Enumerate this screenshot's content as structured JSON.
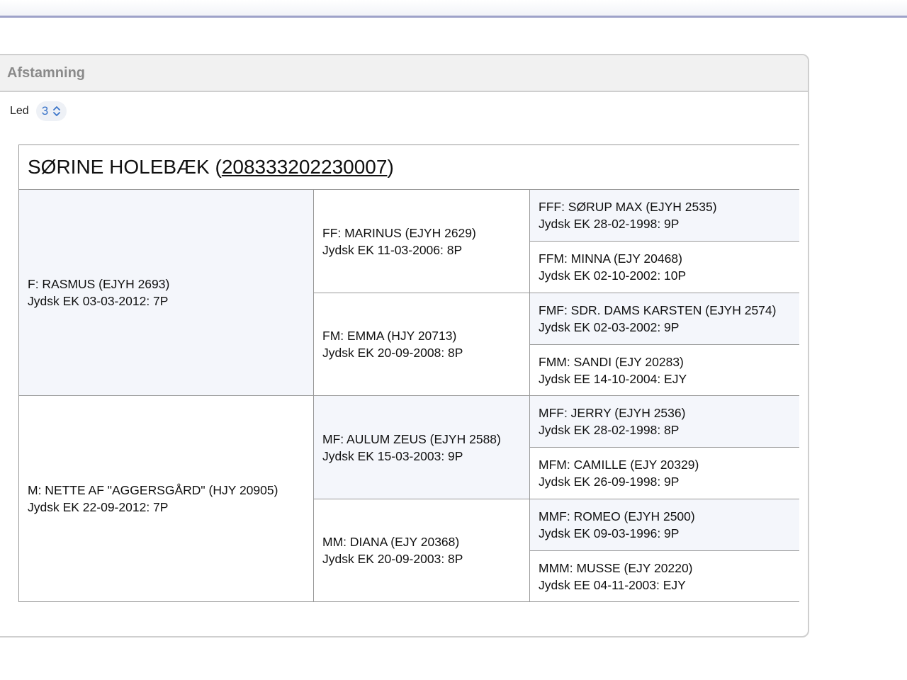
{
  "panel": {
    "title": "Afstamning",
    "led_label": "Led",
    "led_value": "3"
  },
  "pedigree": {
    "animal_name": "SØRINE HOLEBÆK",
    "animal_regno": "208333202230007",
    "F": {
      "name": "F: RASMUS (EJYH 2693)",
      "rating": "Jydsk EK 03-03-2012: 7P"
    },
    "M": {
      "name": "M: NETTE AF \"AGGERSGÅRD\" (HJY 20905)",
      "rating": "Jydsk EK 22-09-2012: 7P"
    },
    "FF": {
      "name": "FF: MARINUS (EJYH 2629)",
      "rating": "Jydsk EK 11-03-2006: 8P"
    },
    "FM": {
      "name": "FM: EMMA (HJY 20713)",
      "rating": "Jydsk EK 20-09-2008: 8P"
    },
    "MF": {
      "name": "MF: AULUM ZEUS (EJYH 2588)",
      "rating": "Jydsk EK 15-03-2003: 9P"
    },
    "MM": {
      "name": "MM: DIANA (EJY 20368)",
      "rating": "Jydsk EK 20-09-2003: 8P"
    },
    "FFF": {
      "name": "FFF: SØRUP MAX (EJYH 2535)",
      "rating": "Jydsk EK 28-02-1998: 9P"
    },
    "FFM": {
      "name": "FFM: MINNA (EJY 20468)",
      "rating": "Jydsk EK 02-10-2002: 10P"
    },
    "FMF": {
      "name": "FMF: SDR. DAMS KARSTEN (EJYH 2574)",
      "rating": "Jydsk EK 02-03-2002: 9P"
    },
    "FMM": {
      "name": "FMM: SANDI (EJY 20283)",
      "rating": "Jydsk EE 14-10-2004: EJY"
    },
    "MFF": {
      "name": "MFF: JERRY (EJYH 2536)",
      "rating": "Jydsk EK 28-02-1998: 8P"
    },
    "MFM": {
      "name": "MFM: CAMILLE (EJY 20329)",
      "rating": "Jydsk EK 26-09-1998: 9P"
    },
    "MMF": {
      "name": "MMF: ROMEO (EJYH 2500)",
      "rating": "Jydsk EK 09-03-1996: 9P"
    },
    "MMM": {
      "name": "MMM: MUSSE (EJY 20220)",
      "rating": "Jydsk EE 04-11-2003: EJY"
    }
  }
}
